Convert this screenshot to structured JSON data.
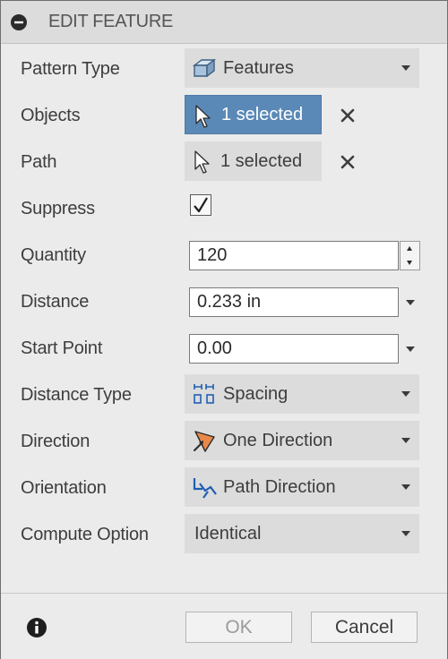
{
  "dialog": {
    "title": "EDIT FEATURE"
  },
  "rows": {
    "pattern_type": {
      "label": "Pattern Type",
      "value": "Features",
      "icon": "box-feature-icon"
    },
    "objects": {
      "label": "Objects",
      "value": "1 selected",
      "icon": "cursor-select-icon",
      "active": true
    },
    "path": {
      "label": "Path",
      "value": "1 selected",
      "icon": "cursor-select-icon"
    },
    "suppress": {
      "label": "Suppress",
      "checked": true
    },
    "quantity": {
      "label": "Quantity",
      "value": "120"
    },
    "distance": {
      "label": "Distance",
      "value": "0.233 in"
    },
    "start_point": {
      "label": "Start Point",
      "value": "0.00"
    },
    "distance_type": {
      "label": "Distance Type",
      "value": "Spacing",
      "icon": "spacing-icon"
    },
    "direction": {
      "label": "Direction",
      "value": "One Direction",
      "icon": "one-direction-icon"
    },
    "orientation": {
      "label": "Orientation",
      "value": "Path Direction",
      "icon": "path-direction-icon"
    },
    "compute_option": {
      "label": "Compute Option",
      "value": "Identical"
    }
  },
  "footer": {
    "ok_label": "OK",
    "cancel_label": "Cancel",
    "info_icon": "info-icon"
  },
  "colors": {
    "dialog_bg": "#ebebeb",
    "titlebar_bg": "#dcdcdc",
    "active_selection": "#5b89b7",
    "direction_icon_orange": "#e8894a",
    "orientation_icon_blue": "#1f5fb5"
  }
}
